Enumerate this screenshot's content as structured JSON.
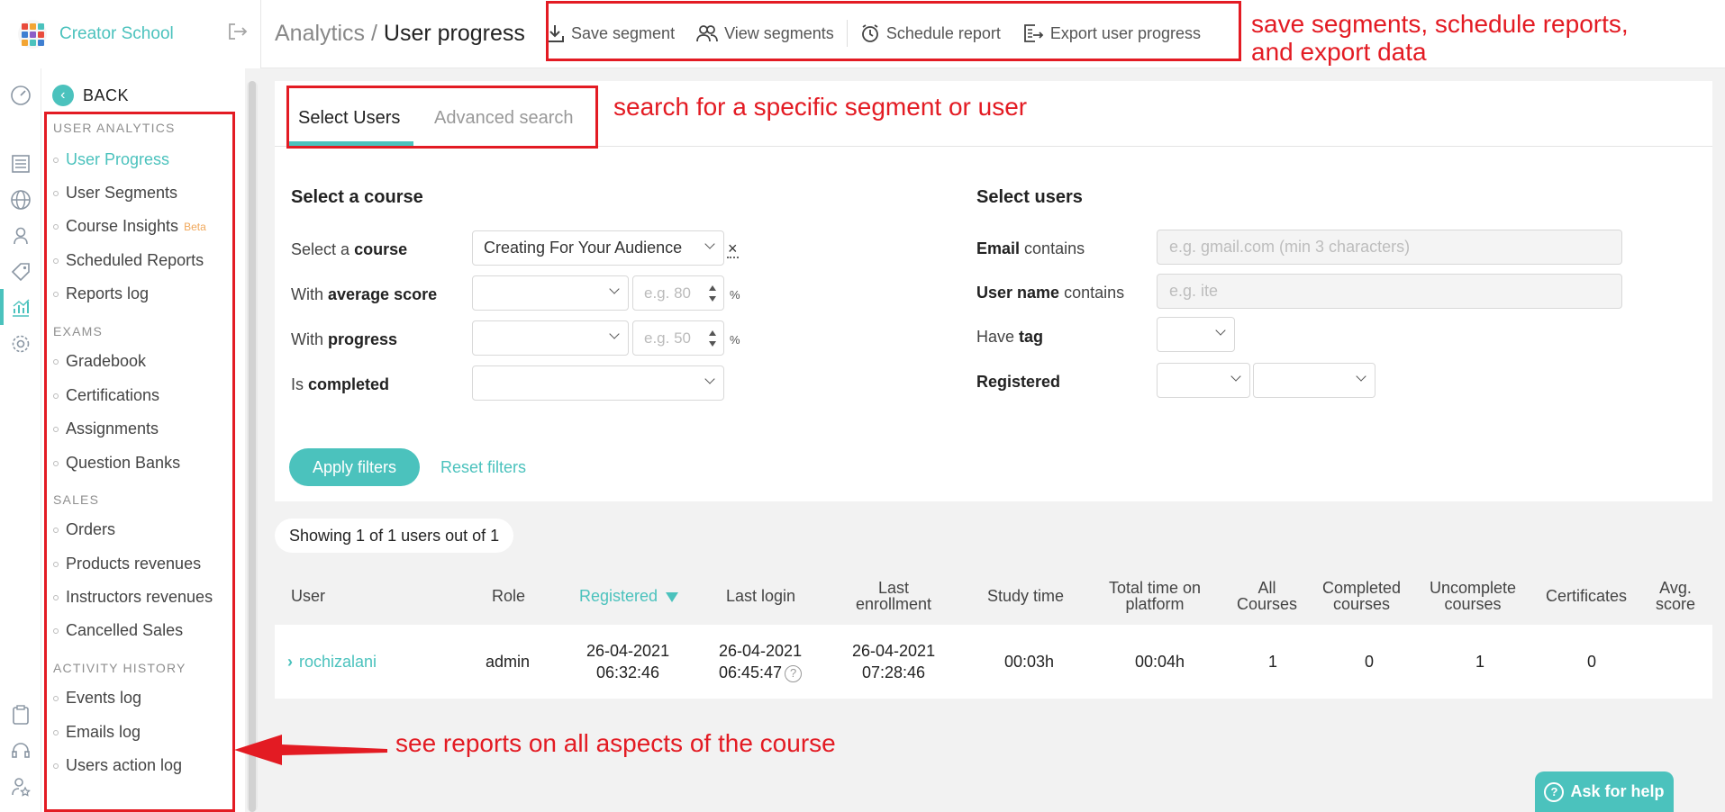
{
  "brand": {
    "name": "Creator School"
  },
  "sidebar": {
    "back_label": "BACK",
    "sections": [
      {
        "title": "USER ANALYTICS",
        "items": [
          "User Progress",
          "User Segments",
          "Course Insights",
          "Scheduled Reports",
          "Reports log"
        ]
      },
      {
        "title": "EXAMS",
        "items": [
          "Gradebook",
          "Certifications",
          "Assignments",
          "Question Banks"
        ]
      },
      {
        "title": "SALES",
        "items": [
          "Orders",
          "Products revenues",
          "Instructors revenues",
          "Cancelled Sales"
        ]
      },
      {
        "title": "ACTIVITY HISTORY",
        "items": [
          "Events log",
          "Emails log",
          "Users action log"
        ]
      }
    ],
    "beta_badge": "Beta"
  },
  "header": {
    "crumb_parent": "Analytics",
    "crumb_sep": "/",
    "crumb_current": "User progress",
    "toolbar": {
      "save_segment": "Save segment",
      "view_segments": "View segments",
      "schedule_report": "Schedule report",
      "export_user_progress": "Export user progress"
    }
  },
  "annotations": {
    "toolbar_line1": "save segments, schedule reports,",
    "toolbar_line2": "and export data",
    "tabs": "search for a specific segment or user",
    "sidebar": "see reports on all aspects of the course"
  },
  "tabs": {
    "select_users": "Select Users",
    "advanced_search": "Advanced search"
  },
  "filters": {
    "course_section_title": "Select a course",
    "users_section_title": "Select users",
    "select_course": {
      "pre": "Select a",
      "bold": "course",
      "value": "Creating For Your Audience",
      "clear": "×"
    },
    "avg_score": {
      "pre": "With",
      "bold": "average score",
      "placeholder": "e.g. 80",
      "unit": "%"
    },
    "progress": {
      "pre": "With",
      "bold": "progress",
      "placeholder": "e.g. 50",
      "unit": "%"
    },
    "completed": {
      "pre": "Is",
      "bold": "completed"
    },
    "email": {
      "bold": "Email",
      "post": "contains",
      "placeholder": "e.g. gmail.com (min 3 characters)"
    },
    "username": {
      "bold": "User name",
      "post": "contains",
      "placeholder": "e.g. ite"
    },
    "tag": {
      "pre": "Have",
      "bold": "tag"
    },
    "registered": {
      "bold": "Registered"
    },
    "apply_label": "Apply filters",
    "reset_label": "Reset filters"
  },
  "summary": {
    "showing": "Showing 1 of 1 users out of 1"
  },
  "table": {
    "columns": {
      "user": "User",
      "role": "Role",
      "registered": "Registered",
      "last_login": "Last login",
      "last_enrollment_1": "Last",
      "last_enrollment_2": "enrollment",
      "study_time": "Study time",
      "total_time_1": "Total time on",
      "total_time_2": "platform",
      "all_courses_1": "All",
      "all_courses_2": "Courses",
      "completed_1": "Completed",
      "completed_2": "courses",
      "uncomplete_1": "Uncomplete",
      "uncomplete_2": "courses",
      "certificates": "Certificates",
      "avg_score_1": "Avg.",
      "avg_score_2": "score"
    },
    "rows": [
      {
        "user": "rochizalani",
        "role": "admin",
        "registered_date": "26-04-2021",
        "registered_time": "06:32:46",
        "last_login_date": "26-04-2021",
        "last_login_time": "06:45:47",
        "last_enrollment_date": "26-04-2021",
        "last_enrollment_time": "07:28:46",
        "study_time": "00:03h",
        "total_time": "00:04h",
        "all_courses": "1",
        "completed": "0",
        "uncomplete": "1",
        "certificates": "0",
        "avg_score": ""
      }
    ]
  },
  "help": {
    "label": "Ask for help"
  },
  "colors": {
    "accent": "#4bc2bd",
    "annotation": "#e31b23",
    "beta": "#f0a85b"
  }
}
